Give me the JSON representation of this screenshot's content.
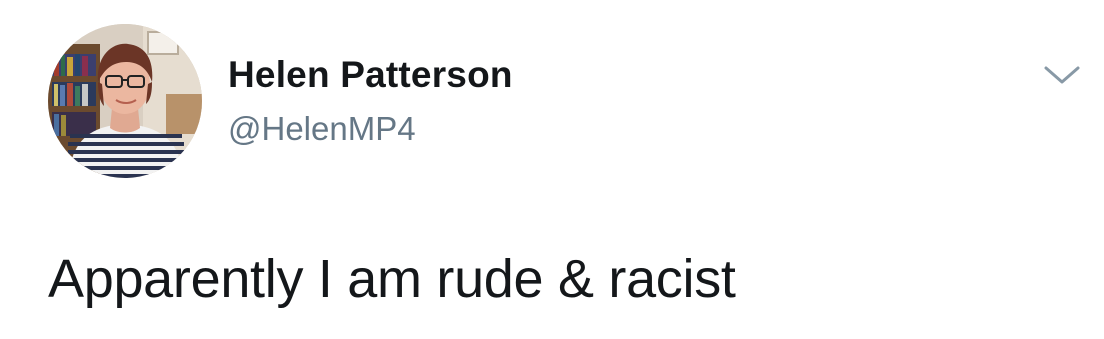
{
  "tweet": {
    "author": {
      "display_name": "Helen Patterson",
      "handle": "@HelenMP4",
      "avatar": "profile-photo"
    },
    "text": "Apparently I am rude & racist",
    "menu_icon": "chevron-down-icon",
    "colors": {
      "name": "#14171a",
      "handle": "#657786",
      "icon": "#8899a6",
      "background": "#ffffff"
    }
  }
}
